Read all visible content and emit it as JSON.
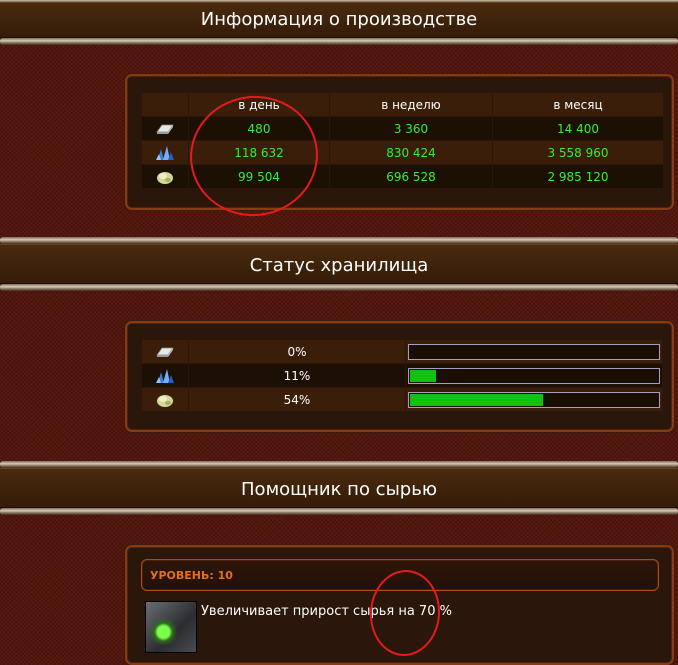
{
  "production": {
    "title": "Информация о производстве",
    "columns": [
      "",
      "в день",
      "в неделю",
      "в месяц"
    ],
    "rows": [
      {
        "icon": "metal-ingot-icon",
        "values": [
          "480",
          "3 360",
          "14 400"
        ]
      },
      {
        "icon": "crystal-icon",
        "values": [
          "118 632",
          "830 424",
          "3 558 960"
        ]
      },
      {
        "icon": "deuterium-icon",
        "values": [
          "99 504",
          "696 528",
          "2 985 120"
        ]
      }
    ]
  },
  "storage": {
    "title": "Статус хранилища",
    "rows": [
      {
        "icon": "metal-ingot-icon",
        "percent_label": "0%",
        "fill": 0
      },
      {
        "icon": "crystal-icon",
        "percent_label": "11%",
        "fill": 11
      },
      {
        "icon": "deuterium-icon",
        "percent_label": "54%",
        "fill": 54
      }
    ]
  },
  "helper": {
    "title": "Помощник по сырью",
    "level_label": "УРОВЕНЬ: 10",
    "description": "Увеличивает прирост сырья на 70 %"
  },
  "colors": {
    "value_text": "#33ee33",
    "progress_fill": "#0fc20f",
    "level_text": "#e2701c",
    "annotation": "#e41b1b"
  }
}
